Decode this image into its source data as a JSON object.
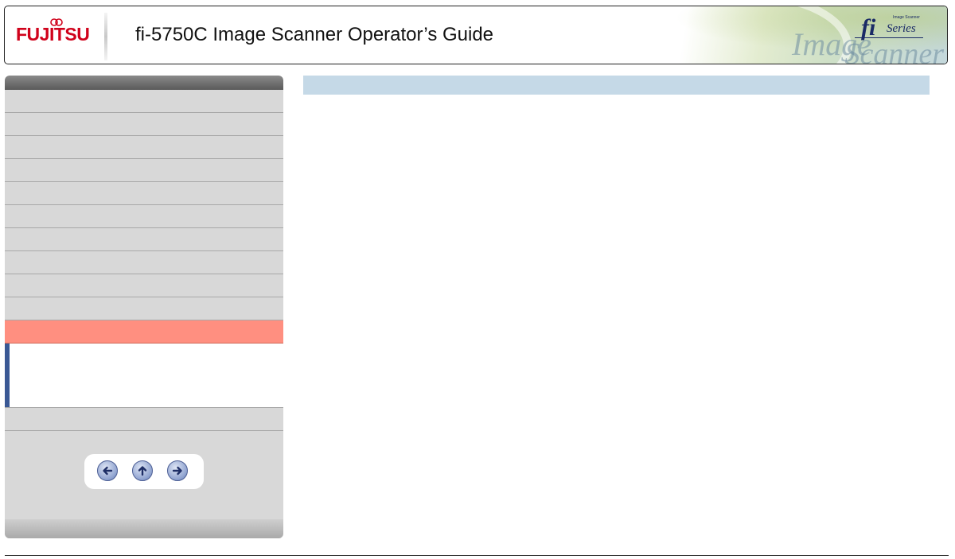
{
  "header": {
    "logo_text": "FUJITSU",
    "title": "fi-5750C Image Scanner Operator’s Guide",
    "banner_words": [
      "Image",
      "Scanner"
    ],
    "badge_fi": "fi",
    "badge_series": "Series",
    "badge_tiny": "Image Scanner"
  },
  "nav": {
    "item_count_before_active": 10,
    "active_color": "#ff8f80",
    "sub_accent_color": "#3a5894",
    "controls": {
      "back_icon": "arrow-left-icon",
      "up_icon": "arrow-up-icon",
      "forward_icon": "arrow-right-icon"
    }
  },
  "content": {
    "title": ""
  },
  "colors": {
    "brand": "#d0021b",
    "nav_bg": "#d8d8d8",
    "content_bar": "#c5d9e7"
  }
}
